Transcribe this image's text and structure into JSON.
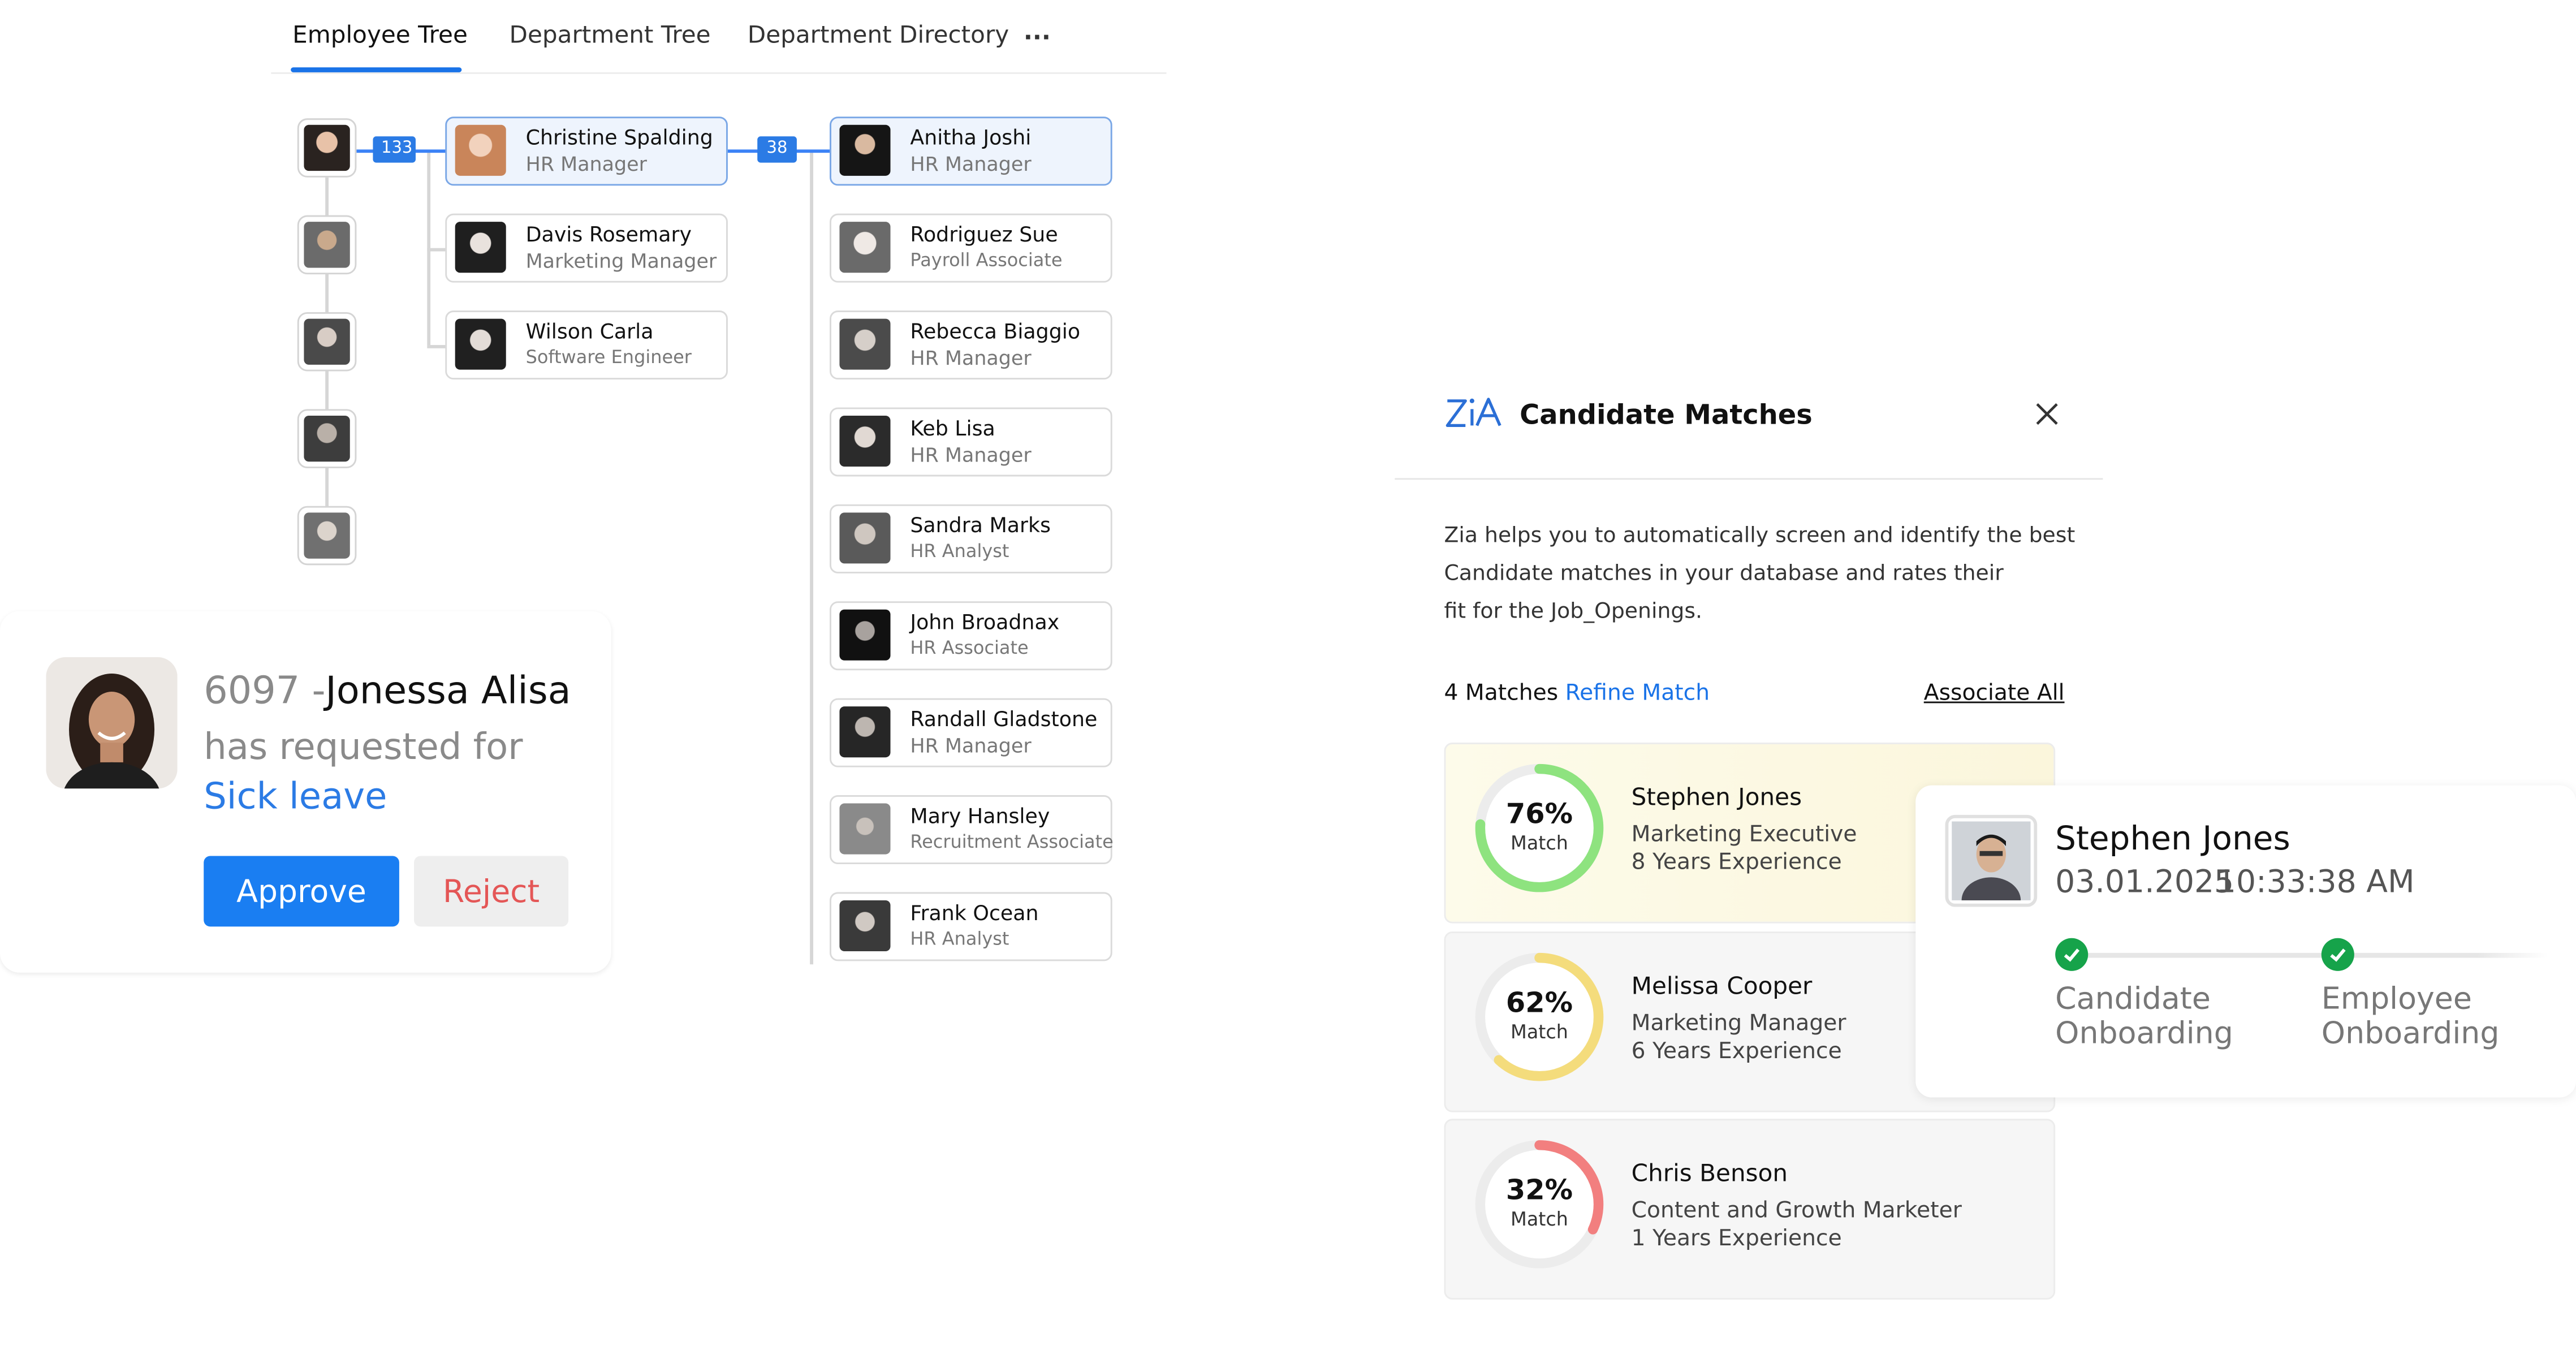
{
  "tabs": {
    "items": [
      "Employee Tree",
      "Department Tree",
      "Department Directory"
    ],
    "more": "...",
    "active": "Employee Tree"
  },
  "tree": {
    "badge_1": "133",
    "badge_2": "38",
    "middle": [
      {
        "name": "Christine Spalding",
        "role": "HR Manager"
      },
      {
        "name": "Davis Rosemary",
        "role": "Marketing Manager"
      },
      {
        "name": "Wilson Carla",
        "role": "Software Engineer"
      }
    ],
    "right": [
      {
        "name": "Anitha Joshi",
        "role": "HR Manager"
      },
      {
        "name": "Rodriguez Sue",
        "role": "Payroll Associate"
      },
      {
        "name": "Rebecca Biaggio",
        "role": "HR Manager"
      },
      {
        "name": "Keb Lisa",
        "role": "HR Manager"
      },
      {
        "name": "Sandra Marks",
        "role": "HR Analyst"
      },
      {
        "name": "John Broadnax",
        "role": "HR Associate"
      },
      {
        "name": "Randall Gladstone",
        "role": "HR Manager"
      },
      {
        "name": "Mary Hansley",
        "role": "Recruitment Associate"
      },
      {
        "name": "Frank Ocean",
        "role": "HR Analyst"
      }
    ]
  },
  "leave": {
    "id": "6097 -",
    "name": "Jonessa Alisa",
    "text": "has requested for",
    "type": "Sick leave",
    "approve_label": "Approve",
    "reject_label": "Reject"
  },
  "candidate_matches": {
    "title": "Candidate Matches",
    "description": [
      "Zia helps you to automatically screen and identify the best",
      "Candidate matches in your database and rates their",
      "fit for the Job_Openings."
    ],
    "matches_count": "4 Matches",
    "refine_label": "Refine Match",
    "associate_all_label": "Associate All",
    "match_label": "Match",
    "matches": [
      {
        "name": "Stephen Jones",
        "role": "Marketing Executive",
        "experience": "8 Years Experience",
        "percent": 76,
        "percent_label": "76%",
        "color": "#8ee37f"
      },
      {
        "name": "Melissa Cooper",
        "role": "Marketing Manager",
        "experience": "6 Years Experience",
        "percent": 62,
        "percent_label": "62%",
        "color": "#f4dc7c"
      },
      {
        "name": "Chris Benson",
        "role": "Content and Growth Marketer",
        "experience": "1 Years Experience",
        "percent": 32,
        "percent_label": "32%",
        "color": "#f27f7f"
      }
    ]
  },
  "onboarding": {
    "name": "Stephen Jones",
    "date": "03.01.2025",
    "time": "10:33:38 AM",
    "steps": [
      {
        "line1": "Candidate",
        "line2": "Onboarding",
        "done": true
      },
      {
        "line1": "Employee",
        "line2": "Onboarding",
        "done": true
      }
    ]
  },
  "colors": {
    "accent": "#1a73e8",
    "approve": "#1a7ef2",
    "reject_text": "#e45656",
    "check": "#16a34a"
  }
}
